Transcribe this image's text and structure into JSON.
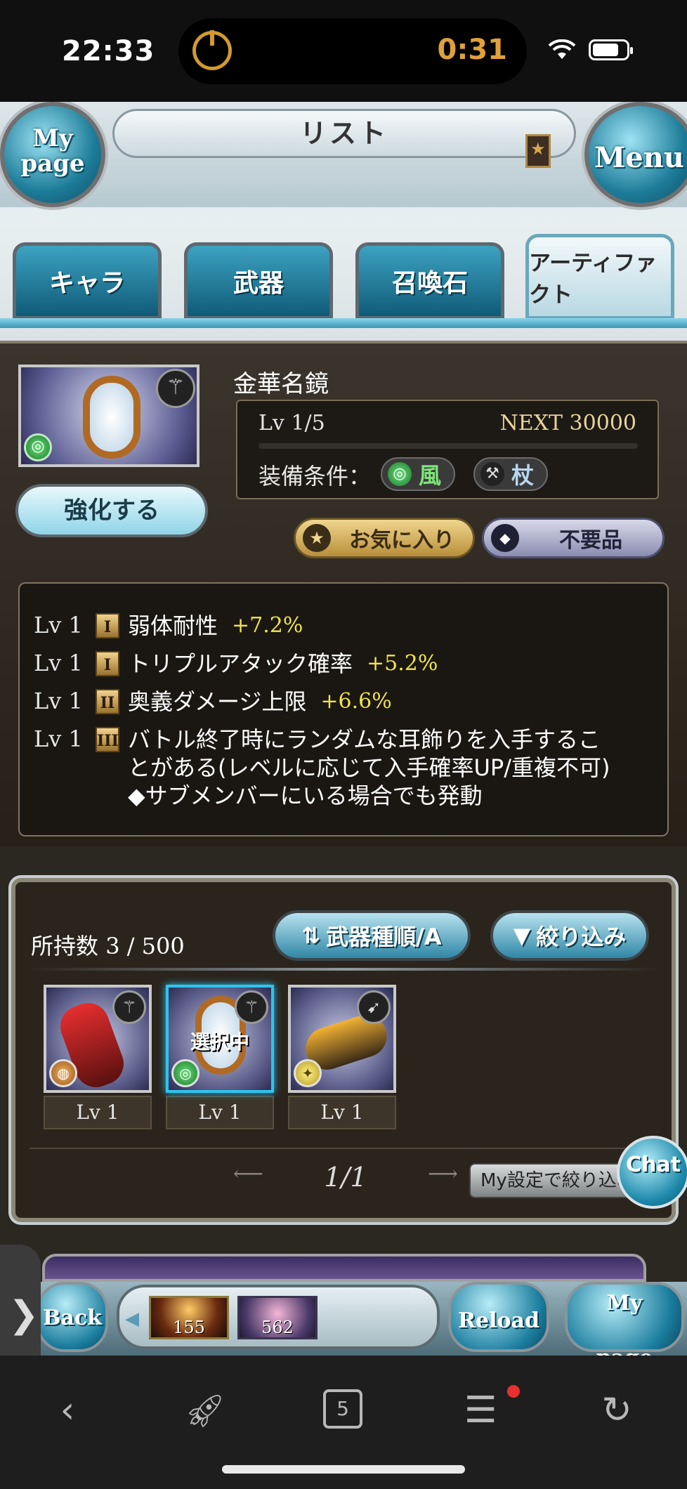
{
  "status_bar": {
    "time": "22:33",
    "timer": "0:31"
  },
  "header": {
    "title": "リスト",
    "mypage_label_1": "My",
    "mypage_label_2": "page",
    "menu_label": "Menu"
  },
  "tabs": [
    {
      "label": "キャラ",
      "active": false
    },
    {
      "label": "武器",
      "active": false
    },
    {
      "label": "召喚石",
      "active": false
    },
    {
      "label": "アーティファクト",
      "active": true
    }
  ],
  "detail": {
    "name": "金華名鏡",
    "level": "Lv 1/5",
    "next": "NEXT 30000",
    "equip_label": "装備条件：",
    "equip_element": "風",
    "equip_weapon": "杖",
    "enhance_button": "強化する",
    "favorite_button": "お気に入り",
    "junk_button": "不要品"
  },
  "skills": [
    {
      "lv": "Lv 1",
      "rank": "I",
      "name": "弱体耐性",
      "value": "+7.2%"
    },
    {
      "lv": "Lv 1",
      "rank": "I",
      "name": "トリプルアタック確率",
      "value": "+5.2%"
    },
    {
      "lv": "Lv 1",
      "rank": "II",
      "name": "奥義ダメージ上限",
      "value": "+6.6%"
    },
    {
      "lv": "Lv 1",
      "rank": "III",
      "name": "バトル終了時にランダムな耳飾りを入手することがある(レベルに応じて入手確率UP/重複不可)　◆サブメンバーにいる場合でも発動",
      "value": ""
    }
  ],
  "inventory": {
    "owned_label": "所持数",
    "owned_count": "3 / 500",
    "sort_button": "武器種順/A",
    "filter_button": "絞り込み",
    "items": [
      {
        "level": "Lv 1",
        "selected": false,
        "selected_text": ""
      },
      {
        "level": "Lv 1",
        "selected": true,
        "selected_text": "選択中"
      },
      {
        "level": "Lv 1",
        "selected": false,
        "selected_text": ""
      }
    ],
    "pager": "1/1",
    "my_setting_button": "My設定で絞り込み"
  },
  "chat_button": "Chat",
  "game_bar": {
    "back_label": "Back",
    "reload_label": "Reload",
    "mypage_label_1": "My",
    "mypage_label_2": "page",
    "tray_item_1_count": "155",
    "tray_item_2_count": "562"
  },
  "browser": {
    "tab_count": "5"
  },
  "colors": {
    "accent_blue": "#2f87a6",
    "bonus_yellow": "#f0e44a",
    "wind_green": "#7fe47a",
    "timer_orange": "#e0a03a"
  }
}
